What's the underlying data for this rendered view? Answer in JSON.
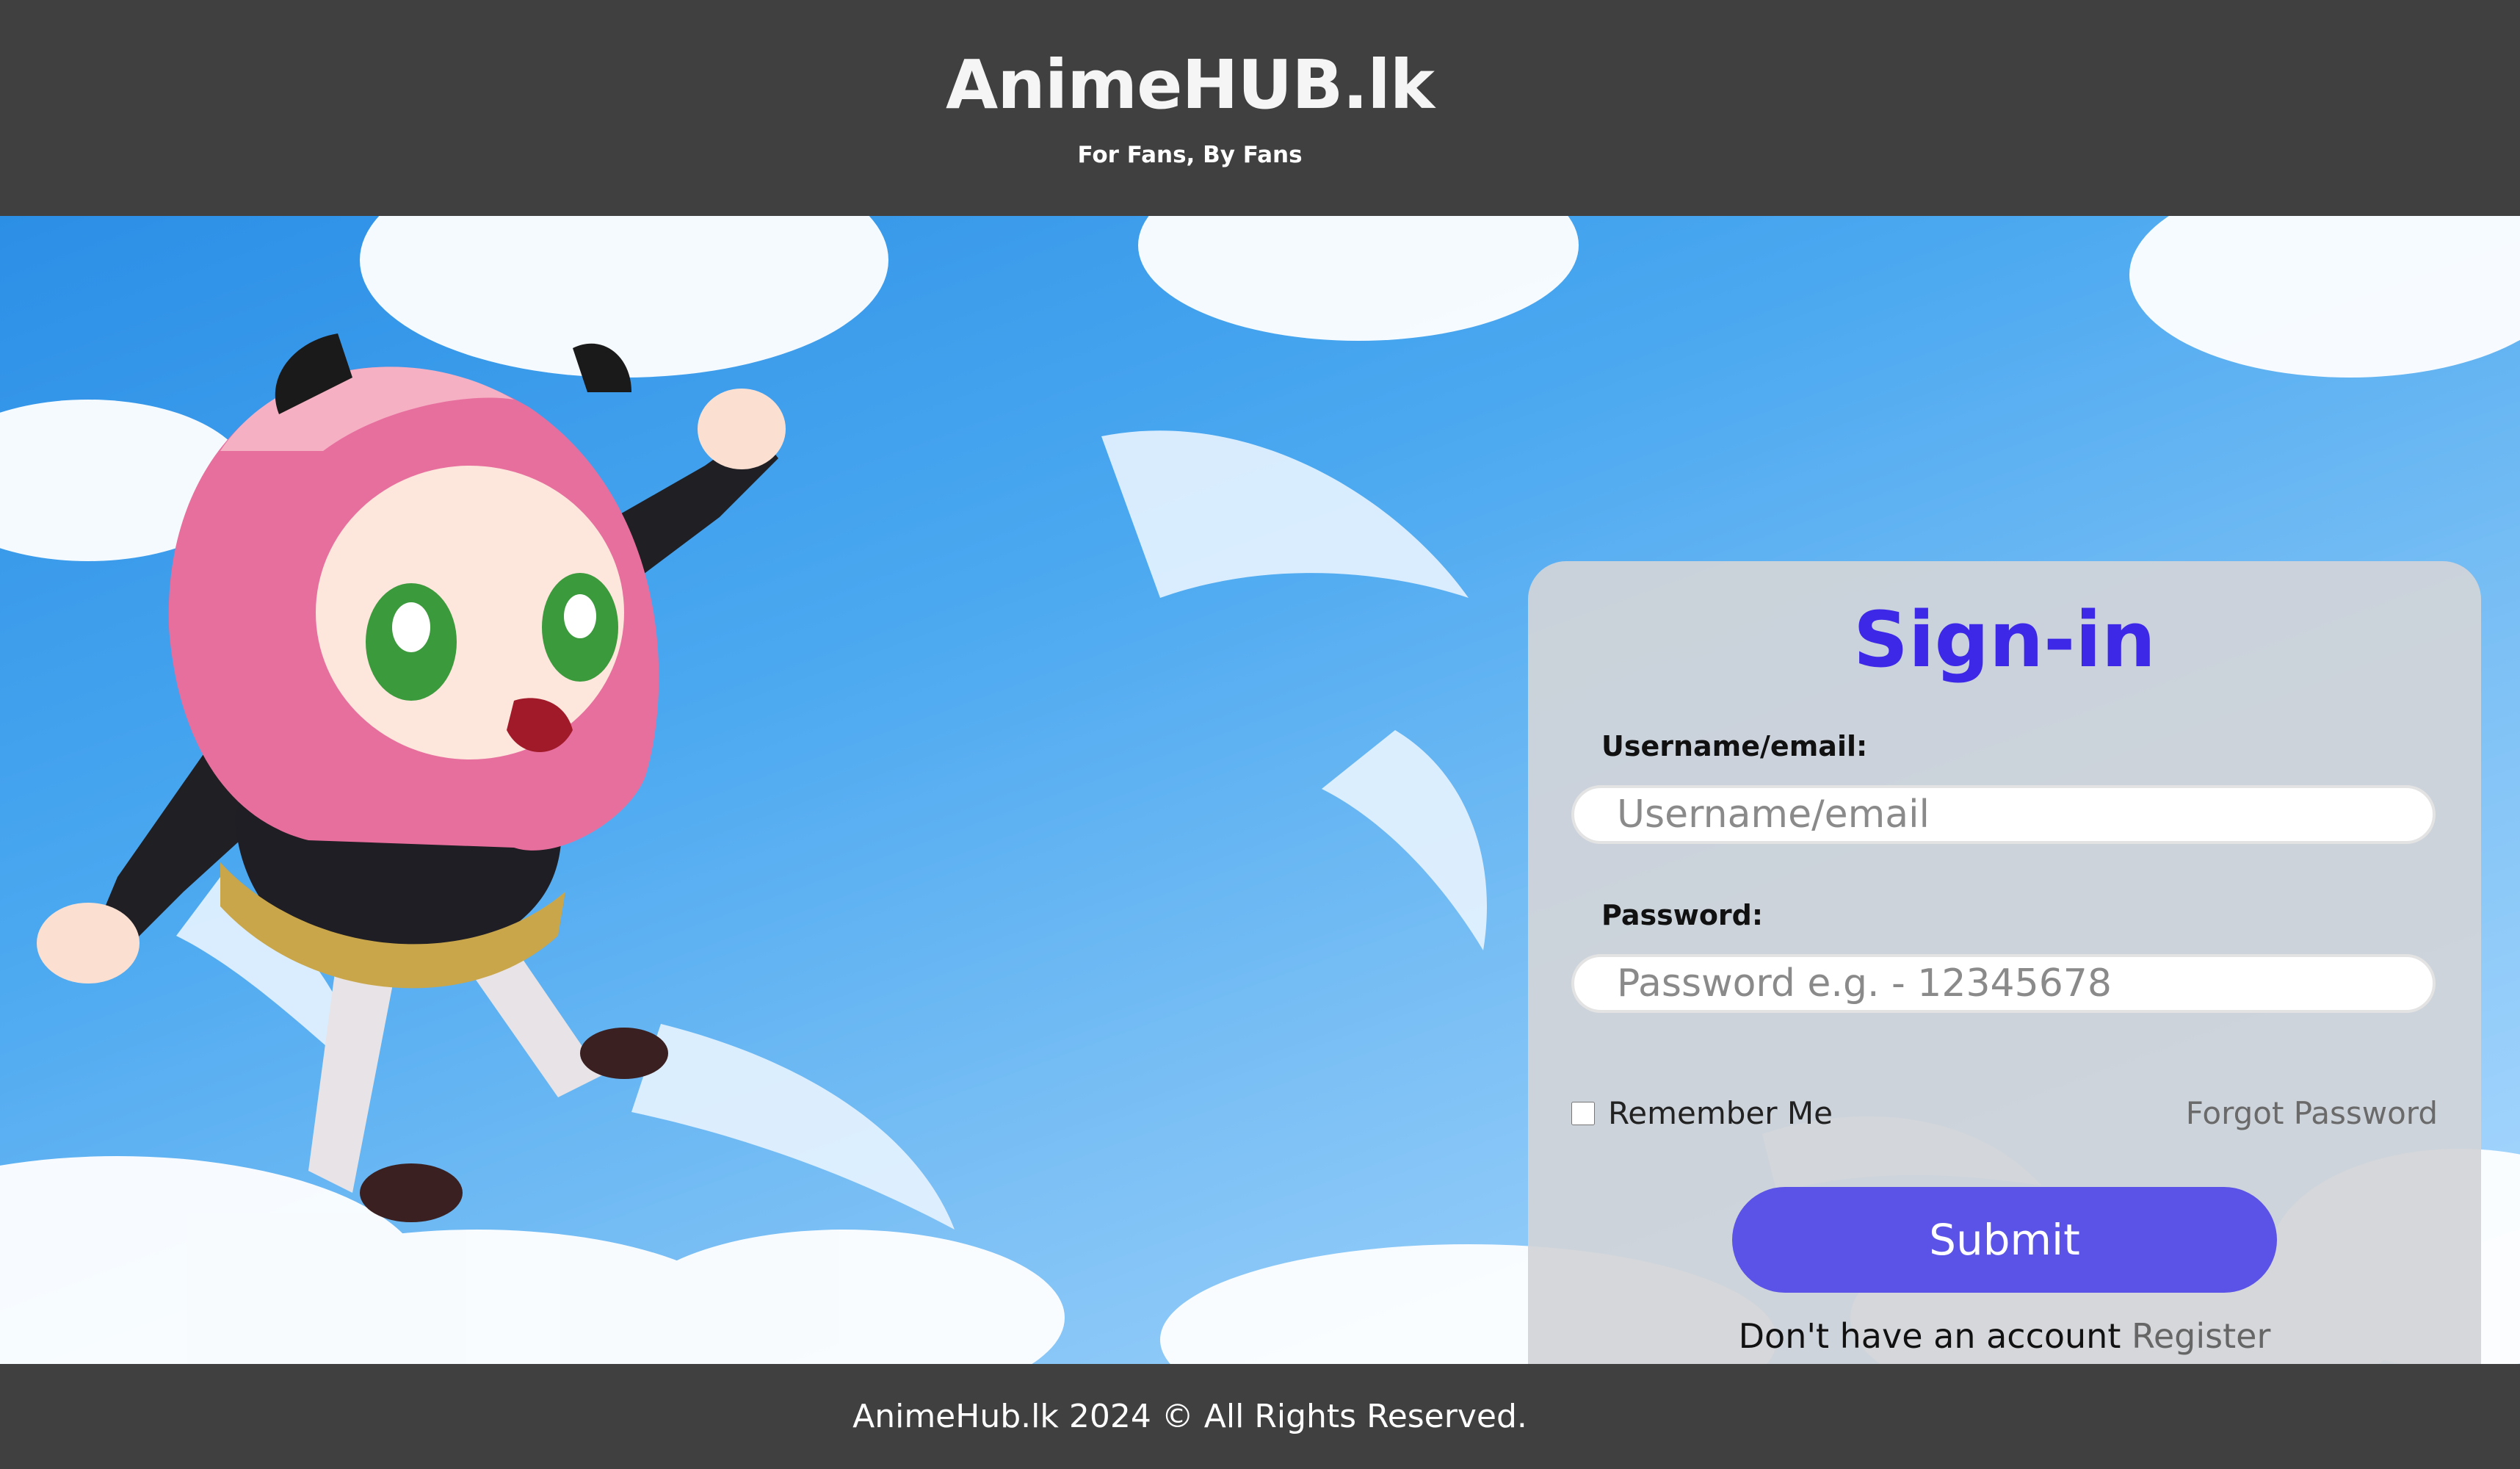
{
  "header": {
    "title": "AnimeHUB.lk",
    "tagline": "For Fans, By Fans"
  },
  "hero": {
    "background_image": "anime-girl-sky-illustration"
  },
  "form": {
    "title": "Sign-in",
    "username_label": "Username/email:",
    "username_placeholder": "Username/email",
    "password_label": "Password:",
    "password_placeholder": "Password e.g. - 12345678",
    "remember_label": "Remember Me",
    "forgot_label": "Forgot Password",
    "submit_label": "Submit",
    "register_prompt": "Don't have an account",
    "register_link": "Register"
  },
  "footer": {
    "text": "AnimeHub.lk 2024 © All Rights Reserved."
  },
  "colors": {
    "header_bg": "#404040",
    "title_accent": "#3d28e8",
    "submit_bg": "#5b52e8",
    "sky_blue": "#4aa8f0"
  }
}
